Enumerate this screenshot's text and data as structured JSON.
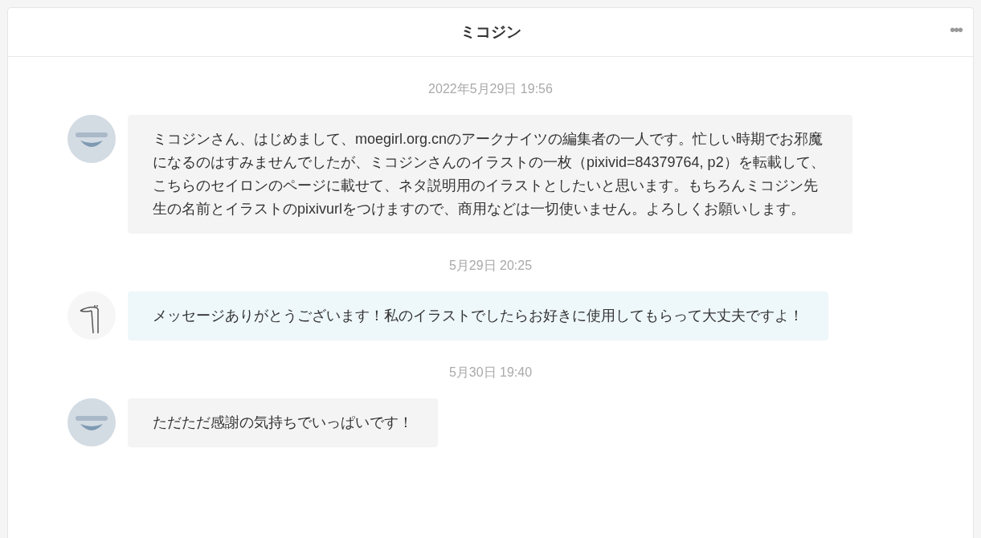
{
  "header": {
    "title": "ミコジン",
    "menu": "•••"
  },
  "messages": [
    {
      "time": "2022年5月29日 19:56",
      "kind": "received",
      "text": "ミコジンさん、はじめまして、moegirl.org.cnのアークナイツの編集者の一人です。忙しい時期でお邪魔になるのはすみませんでしたが、ミコジンさんのイラストの一枚（pixivid=84379764, p2）を転載して、こちらのセイロンのページに載せて、ネタ説明用のイラストとしたいと思います。もちろんミコジン先生の名前とイラストのpixivurlをつけますので、商用などは一切使いません。よろしくお願いします。"
    },
    {
      "time": "5月29日 20:25",
      "kind": "sent",
      "text": "メッセージありがとうございます！私のイラストでしたらお好きに使用してもらって大丈夫ですよ！"
    },
    {
      "time": "5月30日 19:40",
      "kind": "received",
      "text": "ただただ感謝の気持ちでいっぱいです！"
    }
  ]
}
